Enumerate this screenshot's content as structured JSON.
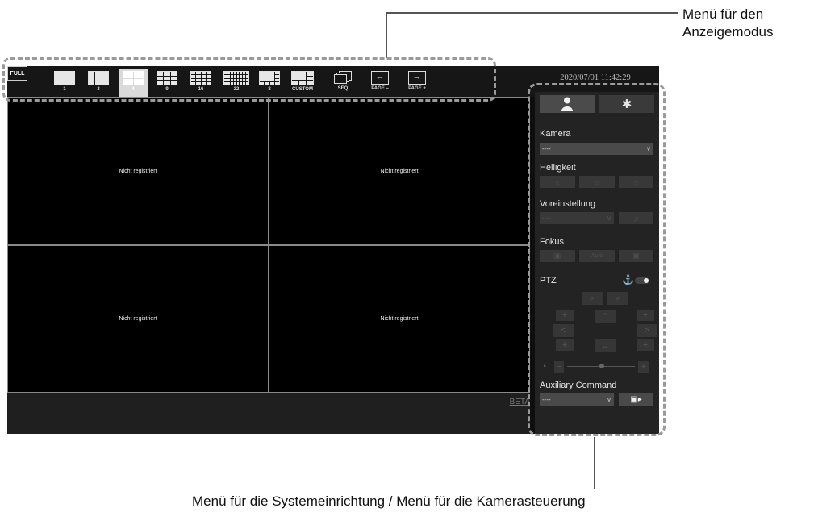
{
  "callouts": {
    "top_line1": "Menü für den",
    "top_line2": "Anzeigemodus",
    "bottom": "Menü für die Systemeinrichtung / Menü für die Kamerasteuerung"
  },
  "toolbar": {
    "full": "FULL",
    "layouts": [
      {
        "label": "1",
        "icon": "layout-1-icon"
      },
      {
        "label": "3",
        "icon": "layout-3-icon"
      },
      {
        "label": "4",
        "icon": "layout-4-icon"
      },
      {
        "label": "9",
        "icon": "layout-9-icon"
      },
      {
        "label": "16",
        "icon": "layout-16-icon"
      },
      {
        "label": "32",
        "icon": "layout-32-icon"
      },
      {
        "label": "8",
        "icon": "layout-8-icon"
      },
      {
        "label": "CUSTOM",
        "icon": "layout-custom-icon"
      },
      {
        "label": "SEQ",
        "icon": "sequence-icon"
      },
      {
        "label": "PAGE –",
        "icon": "arrow-left-icon"
      },
      {
        "label": "PAGE +",
        "icon": "arrow-right-icon"
      }
    ],
    "active_layout": "4"
  },
  "datetime": "2020/07/01 11:42:29",
  "video": {
    "tiles": [
      "Nicht registriert",
      "Nicht registriert",
      "Nicht registriert",
      "Nicht registriert"
    ]
  },
  "bottom": {
    "beta": "BETA"
  },
  "panel": {
    "tabs": [
      {
        "icon": "user-icon"
      },
      {
        "icon": "gear-icon"
      }
    ],
    "camera_label": "Kamera",
    "camera_value": "----",
    "brightness_label": "Helligkeit",
    "preset_label": "Voreinstellung",
    "preset_value": "----",
    "focus_label": "Fokus",
    "focus_buttons": [
      "",
      "Auto",
      ""
    ],
    "ptz_label": "PTZ",
    "aux_label": "Auxiliary Command",
    "aux_value": "----"
  },
  "colors": {
    "screen_bg": "#0e0e0e",
    "panel_bg": "#232323",
    "highlight_dash": "#9a9a9a"
  }
}
